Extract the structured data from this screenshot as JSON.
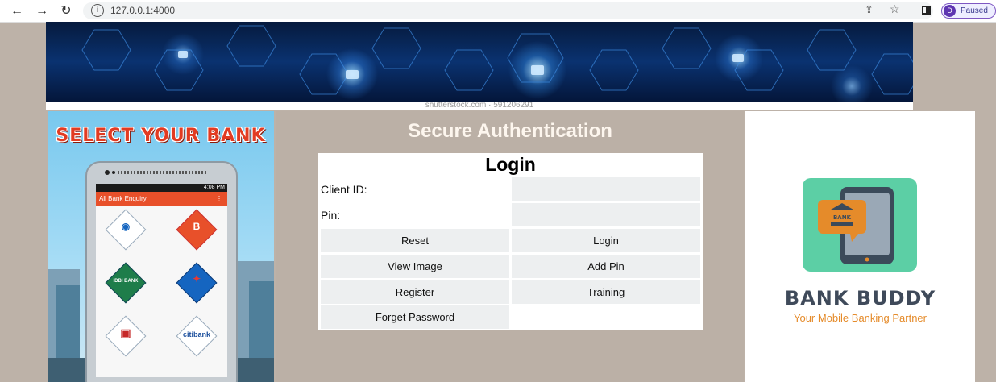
{
  "browser": {
    "url": "127.0.0.1:4000",
    "profile_initial": "D",
    "profile_status": "Paused",
    "icons": [
      "back-arrow-icon",
      "forward-arrow-icon",
      "reload-icon",
      "info-icon",
      "share-icon",
      "star-icon",
      "side-panel-icon"
    ]
  },
  "banner": {
    "watermark": "shutterstock.com · 591206291"
  },
  "left_promo": {
    "headline": "SELECT YOUR BANK",
    "app_title": "All Bank Enquiry",
    "status_time": "4:08 PM",
    "banks": [
      "State Bank of India",
      "Bank of Baroda",
      "IDBI BANK",
      "Central Bank of India",
      "HDFC BANK",
      "citibank"
    ]
  },
  "main": {
    "heading": "Secure Authentication",
    "login": {
      "title": "Login",
      "client_id_label": "Client ID:",
      "client_id_value": "",
      "pin_label": "Pin:",
      "pin_value": "",
      "buttons": {
        "reset": "Reset",
        "login": "Login",
        "view_image": "View Image",
        "add_pin": "Add Pin",
        "register": "Register",
        "training": "Training",
        "forget_password": "Forget Password"
      }
    }
  },
  "right_promo": {
    "brand": "BANK BUDDY",
    "tagline": "Your Mobile Banking Partner",
    "bank_sign": "BANK"
  },
  "colors": {
    "page_bg": "#bdb2a8",
    "heading_text": "#fdf6ee",
    "button_bg": "#edeff0",
    "brand_accent": "#e58b2a",
    "app_bar": "#e8502a"
  }
}
